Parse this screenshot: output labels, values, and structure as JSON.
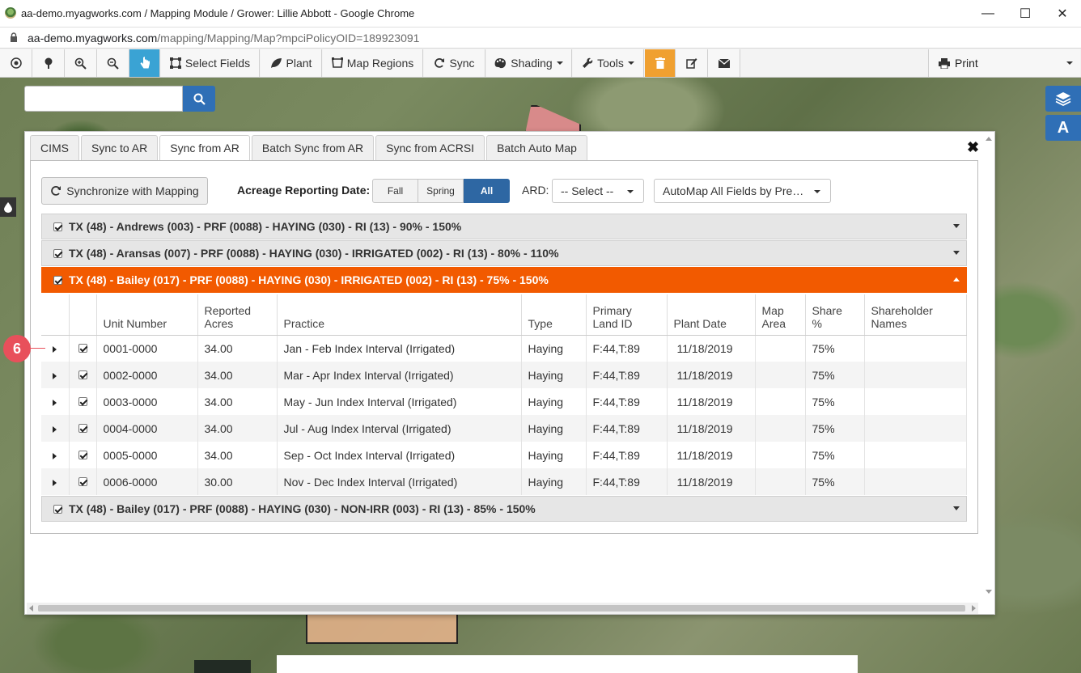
{
  "browser": {
    "window_title": "aa-demo.myagworks.com / Mapping Module / Grower: Lillie Abbott - Google Chrome",
    "url_host": "aa-demo.myagworks.com",
    "url_path": "/mapping/Mapping/Map?mpciPolicyOID=189923091"
  },
  "toolbar": {
    "select_fields": "Select Fields",
    "plant": "Plant",
    "map_regions": "Map Regions",
    "sync": "Sync",
    "shading": "Shading",
    "tools": "Tools",
    "print": "Print"
  },
  "dialog": {
    "tabs": [
      "CIMS",
      "Sync to AR",
      "Sync from AR",
      "Batch Sync from AR",
      "Sync from ACRSI",
      "Batch Auto Map"
    ],
    "active_tab": "Sync from AR",
    "sync_button": "Synchronize with Mapping",
    "ard_label": "Acreage Reporting Date:",
    "seasons": [
      "Fall",
      "Spring",
      "All"
    ],
    "selected_season": "All",
    "ard_short": "ARD:",
    "ard_select": "-- Select --",
    "automap_select": "AutoMap All Fields by Pre…"
  },
  "policies": [
    {
      "label": "TX (48) - Andrews (003) - PRF (0088) - HAYING (030) - RI (13) - 90% - 150%",
      "expanded": false
    },
    {
      "label": "TX (48) - Aransas (007) - PRF (0088) - HAYING (030) - IRRIGATED (002) - RI (13) - 80% - 110%",
      "expanded": false
    },
    {
      "label": "TX (48) - Bailey (017) - PRF (0088) - HAYING (030) - IRRIGATED (002) - RI (13) - 75% - 150%",
      "expanded": true
    },
    {
      "label": "TX (48) - Bailey (017) - PRF (0088) - HAYING (030) - NON-IRR (003) - RI (13) - 85% - 150%",
      "expanded": false
    }
  ],
  "table": {
    "headers": [
      "Unit Number",
      "Reported Acres",
      "Practice",
      "Type",
      "Primary Land ID",
      "Plant Date",
      "Map Area",
      "Share %",
      "Shareholder Names"
    ],
    "header_lines": [
      [
        "Unit Number"
      ],
      [
        "Reported",
        "Acres"
      ],
      [
        "Practice"
      ],
      [
        "Type"
      ],
      [
        "Primary",
        "Land ID"
      ],
      [
        "Plant Date"
      ],
      [
        "Map",
        "Area"
      ],
      [
        "Share",
        "%"
      ],
      [
        "Shareholder",
        "Names"
      ]
    ],
    "rows": [
      {
        "unit": "0001-0000",
        "acres": "34.00",
        "practice": "Jan - Feb Index Interval (Irrigated)",
        "type": "Haying",
        "land_id": "F:44,T:89",
        "plant_date": "11/18/2019",
        "map_area": "",
        "share": "75%",
        "shareholders": ""
      },
      {
        "unit": "0002-0000",
        "acres": "34.00",
        "practice": "Mar - Apr Index Interval (Irrigated)",
        "type": "Haying",
        "land_id": "F:44,T:89",
        "plant_date": "11/18/2019",
        "map_area": "",
        "share": "75%",
        "shareholders": ""
      },
      {
        "unit": "0003-0000",
        "acres": "34.00",
        "practice": "May - Jun Index Interval (Irrigated)",
        "type": "Haying",
        "land_id": "F:44,T:89",
        "plant_date": "11/18/2019",
        "map_area": "",
        "share": "75%",
        "shareholders": ""
      },
      {
        "unit": "0004-0000",
        "acres": "34.00",
        "practice": "Jul - Aug Index Interval (Irrigated)",
        "type": "Haying",
        "land_id": "F:44,T:89",
        "plant_date": "11/18/2019",
        "map_area": "",
        "share": "75%",
        "shareholders": ""
      },
      {
        "unit": "0005-0000",
        "acres": "34.00",
        "practice": "Sep - Oct Index Interval (Irrigated)",
        "type": "Haying",
        "land_id": "F:44,T:89",
        "plant_date": "11/18/2019",
        "map_area": "",
        "share": "75%",
        "shareholders": ""
      },
      {
        "unit": "0006-0000",
        "acres": "30.00",
        "practice": "Nov - Dec Index Interval (Irrigated)",
        "type": "Haying",
        "land_id": "F:44,T:89",
        "plant_date": "11/18/2019",
        "map_area": "",
        "share": "75%",
        "shareholders": ""
      }
    ]
  },
  "callout": "6",
  "colors": {
    "accent": "#f25a00",
    "primary": "#2e67a3",
    "active_tool": "#3aa3d4",
    "callout": "#e8505b"
  }
}
